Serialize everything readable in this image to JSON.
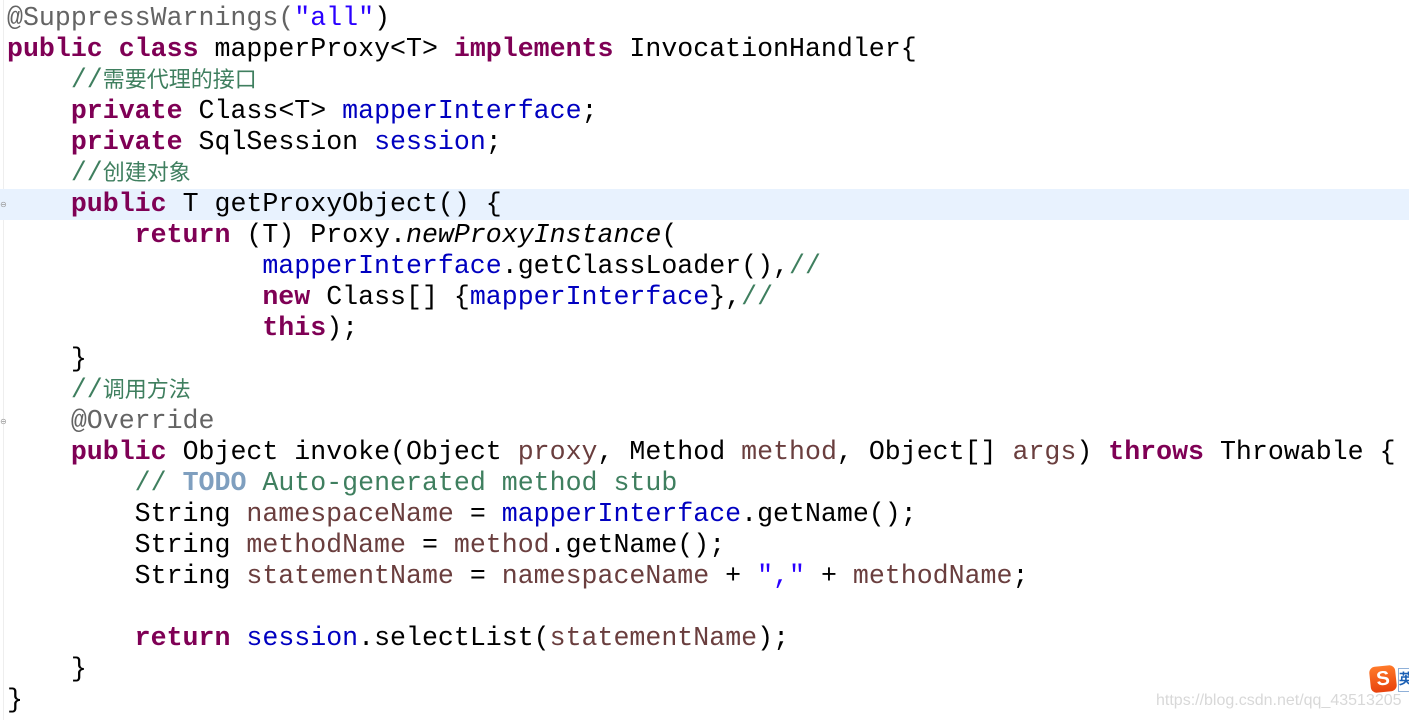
{
  "editor": {
    "highlighted_line": 6,
    "fold_markers": [
      6,
      13
    ],
    "colors": {
      "keyword": "#7f0055",
      "string": "#2a00ff",
      "field": "#0000c0",
      "comment": "#3f7f5f",
      "annotation": "#646464",
      "local_variable": "#6a3e3e",
      "todo": "#7f9fbf",
      "current_line": "#e8f2fe"
    },
    "lines": [
      [
        [
          "@SuppressWarnings(",
          "ann"
        ],
        [
          "\"all\"",
          "str"
        ],
        [
          ")",
          ""
        ]
      ],
      [
        [
          "public",
          "kw"
        ],
        [
          " ",
          ""
        ],
        [
          "class",
          "kw"
        ],
        [
          " mapperProxy<T> ",
          ""
        ],
        [
          "implements",
          "kw"
        ],
        [
          " InvocationHandler{",
          ""
        ]
      ],
      [
        [
          "    ",
          ""
        ],
        [
          "//",
          "cmt"
        ],
        [
          "需要代理的接口",
          "cmt cjk"
        ]
      ],
      [
        [
          "    ",
          ""
        ],
        [
          "private",
          "kw"
        ],
        [
          " Class<T> ",
          ""
        ],
        [
          "mapperInterface",
          "fld"
        ],
        [
          ";",
          ""
        ]
      ],
      [
        [
          "    ",
          ""
        ],
        [
          "private",
          "kw"
        ],
        [
          " SqlSession ",
          ""
        ],
        [
          "session",
          "fld"
        ],
        [
          ";",
          ""
        ]
      ],
      [
        [
          "    ",
          ""
        ],
        [
          "//",
          "cmt"
        ],
        [
          "创建对象",
          "cmt cjk"
        ]
      ],
      [
        [
          "    ",
          ""
        ],
        [
          "public",
          "kw"
        ],
        [
          " T getProxyObject() {",
          ""
        ]
      ],
      [
        [
          "        ",
          ""
        ],
        [
          "return",
          "kw"
        ],
        [
          " (T) Proxy.",
          ""
        ],
        [
          "newProxyInstance",
          "it"
        ],
        [
          "(",
          ""
        ]
      ],
      [
        [
          "                ",
          ""
        ],
        [
          "mapperInterface",
          "fld"
        ],
        [
          ".getClassLoader(),",
          ""
        ],
        [
          "//",
          "cmt"
        ]
      ],
      [
        [
          "                ",
          ""
        ],
        [
          "new",
          "kw"
        ],
        [
          " Class[] {",
          ""
        ],
        [
          "mapperInterface",
          "fld"
        ],
        [
          "},",
          ""
        ],
        [
          "//",
          "cmt"
        ]
      ],
      [
        [
          "                ",
          ""
        ],
        [
          "this",
          "kw"
        ],
        [
          ");",
          ""
        ]
      ],
      [
        [
          "    }",
          ""
        ]
      ],
      [
        [
          "    ",
          ""
        ],
        [
          "//",
          "cmt"
        ],
        [
          "调用方法",
          "cmt cjk"
        ]
      ],
      [
        [
          "    ",
          ""
        ],
        [
          "@Override",
          "ann"
        ]
      ],
      [
        [
          "    ",
          ""
        ],
        [
          "public",
          "kw"
        ],
        [
          " Object invoke(Object ",
          ""
        ],
        [
          "proxy",
          "var"
        ],
        [
          ", Method ",
          ""
        ],
        [
          "method",
          "var"
        ],
        [
          ", Object[] ",
          ""
        ],
        [
          "args",
          "var"
        ],
        [
          ") ",
          ""
        ],
        [
          "throws",
          "kw"
        ],
        [
          " Throwable {",
          ""
        ]
      ],
      [
        [
          "        ",
          ""
        ],
        [
          "// ",
          "cmt"
        ],
        [
          "TODO",
          "todo"
        ],
        [
          " Auto-generated method stub",
          "cmt"
        ]
      ],
      [
        [
          "        String ",
          ""
        ],
        [
          "namespaceName",
          "var"
        ],
        [
          " = ",
          ""
        ],
        [
          "mapperInterface",
          "fld"
        ],
        [
          ".getName();",
          ""
        ]
      ],
      [
        [
          "        String ",
          ""
        ],
        [
          "methodName",
          "var"
        ],
        [
          " = ",
          ""
        ],
        [
          "method",
          "var"
        ],
        [
          ".getName();",
          ""
        ]
      ],
      [
        [
          "        String ",
          ""
        ],
        [
          "statementName",
          "var"
        ],
        [
          " = ",
          ""
        ],
        [
          "namespaceName",
          "var"
        ],
        [
          " + ",
          ""
        ],
        [
          "\",\"",
          "str"
        ],
        [
          " + ",
          ""
        ],
        [
          "methodName",
          "var"
        ],
        [
          ";",
          ""
        ]
      ],
      [],
      [
        [
          "        ",
          ""
        ],
        [
          "return",
          "kw"
        ],
        [
          " ",
          ""
        ],
        [
          "session",
          "fld"
        ],
        [
          ".selectList(",
          ""
        ],
        [
          "statementName",
          "var"
        ],
        [
          ");",
          ""
        ]
      ],
      [
        [
          "    }",
          ""
        ]
      ],
      [
        [
          "}",
          ""
        ]
      ]
    ]
  },
  "watermark": "https://blog.csdn.net/qq_43513205",
  "ime": {
    "logo": "S",
    "tab": "英"
  }
}
